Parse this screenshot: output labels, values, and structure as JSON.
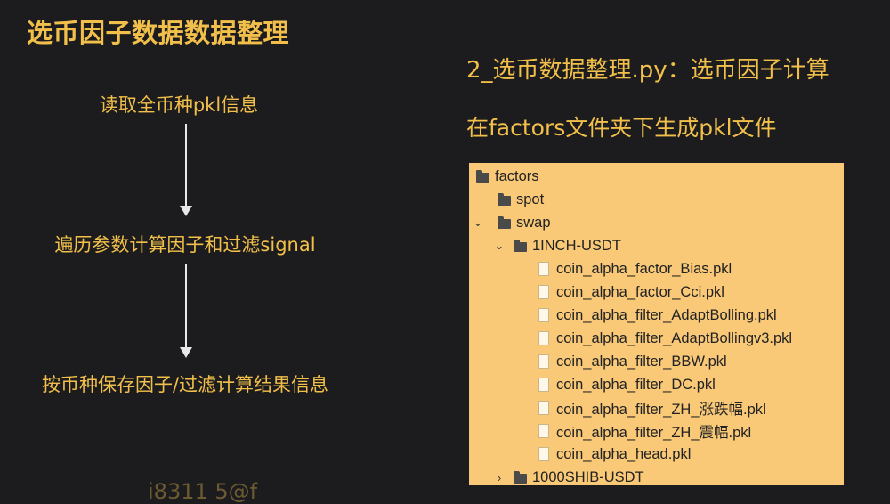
{
  "page": {
    "title": "选币因子数据数据整理"
  },
  "flow": {
    "step1": "读取全币种pkl信息",
    "step2": "遍历参数计算因子和过滤signal",
    "step3": "按币种保存因子/过滤计算结果信息"
  },
  "right": {
    "subtitle": "2_选币数据整理.py：选币因子计算",
    "description": "在factors文件夹下生成pkl文件"
  },
  "tree": {
    "root": "factors",
    "spot": "spot",
    "swap": "swap",
    "folder_expanded": "1INCH-USDT",
    "files": [
      "coin_alpha_factor_Bias.pkl",
      "coin_alpha_factor_Cci.pkl",
      "coin_alpha_filter_AdaptBolling.pkl",
      "coin_alpha_filter_AdaptBollingv3.pkl",
      "coin_alpha_filter_BBW.pkl",
      "coin_alpha_filter_DC.pkl",
      "coin_alpha_filter_ZH_涨跌幅.pkl",
      "coin_alpha_filter_ZH_震幅.pkl",
      "coin_alpha_head.pkl"
    ],
    "folder_collapsed": "1000SHIB-USDT"
  },
  "footer": {
    "watermark": "i8311 5@f"
  }
}
